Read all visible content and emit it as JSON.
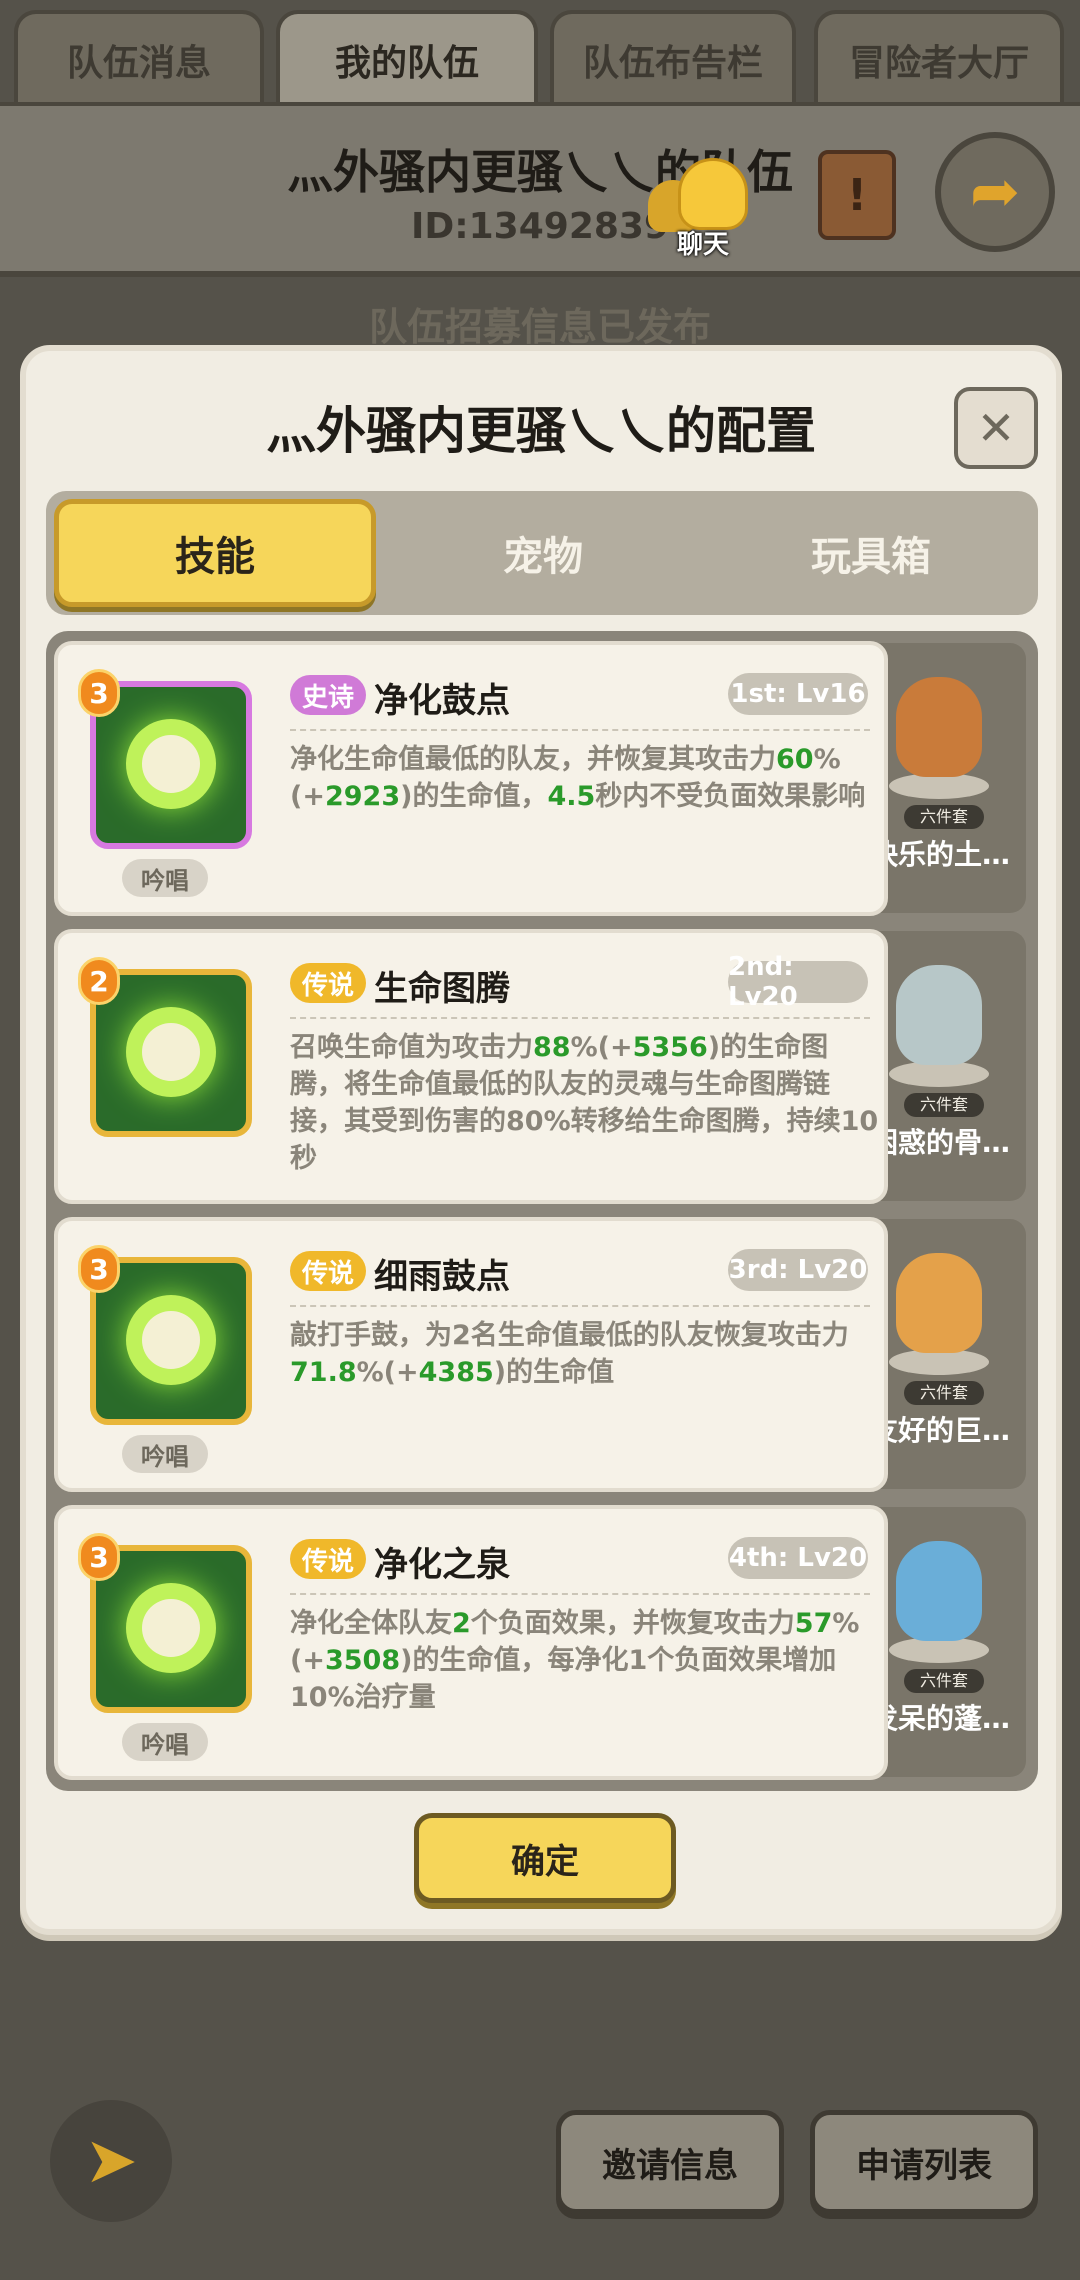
{
  "top_tabs": [
    "队伍消息",
    "我的队伍",
    "队伍布告栏",
    "冒险者大厅"
  ],
  "active_top_tab": 1,
  "header": {
    "team_name": "灬外骚内更骚乀乀的队伍",
    "team_id": "ID:13492839",
    "chat_label": "聊天",
    "scroll_icon_glyph": "!",
    "back_icon": "return-arrow-icon"
  },
  "recruit_notice": "队伍招募信息已发布",
  "modal": {
    "title": "灬外骚内更骚乀乀的配置",
    "close_glyph": "✕",
    "tabs": [
      "技能",
      "宠物",
      "玩具箱"
    ],
    "active_tab": 0,
    "confirm_label": "确定"
  },
  "skills": [
    {
      "level_badge": "3",
      "rarity": "史诗",
      "rarity_type": "epic",
      "name": "净化鼓点",
      "slot_level": "1st: Lv16",
      "chant": "吟唱",
      "desc_html": "净化生命值最低的队友，并恢复其攻击力<span class=\"hl\">60</span>%(+<span class=\"hl\">2923</span>)的生命值，<span class=\"hl\">4.5</span>秒内不受负面效果影响",
      "pet_set": "六件套",
      "pet_name": "快乐的土…",
      "pet_color": "#c97b3a"
    },
    {
      "level_badge": "2",
      "rarity": "传说",
      "rarity_type": "legend",
      "name": "生命图腾",
      "slot_level": "2nd: Lv20",
      "chant": "",
      "desc_html": "召唤生命值为攻击力<span class=\"hl\">88</span>%(+<span class=\"hl\">5356</span>)的生命图腾，将生命值最低的队友的灵魂与生命图腾链接，其受到伤害的80%转移给生命图腾，持续10秒",
      "pet_set": "六件套",
      "pet_name": "困惑的骨…",
      "pet_color": "#b7c7c8"
    },
    {
      "level_badge": "3",
      "rarity": "传说",
      "rarity_type": "legend",
      "name": "细雨鼓点",
      "slot_level": "3rd: Lv20",
      "chant": "吟唱",
      "desc_html": "敲打手鼓，为2名生命值最低的队友恢复攻击力<span class=\"hl\">71.8</span>%(+<span class=\"hl\">4385</span>)的生命值",
      "pet_set": "六件套",
      "pet_name": "友好的巨…",
      "pet_color": "#e4a14a"
    },
    {
      "level_badge": "3",
      "rarity": "传说",
      "rarity_type": "legend",
      "name": "净化之泉",
      "slot_level": "4th: Lv20",
      "chant": "吟唱",
      "desc_html": "净化全体队友<span class=\"hl\">2</span>个负面效果，并恢复攻击力<span class=\"hl\">57</span>%(+<span class=\"hl\">3508</span>)的生命值，每净化1个负面效果增加10%治疗量",
      "pet_set": "六件套",
      "pet_name": "发呆的蓬…",
      "pet_color": "#6aaed8"
    }
  ],
  "bottom": {
    "back_icon": "back-arrow-icon",
    "invite_label": "邀请信息",
    "apply_label": "申请列表"
  }
}
